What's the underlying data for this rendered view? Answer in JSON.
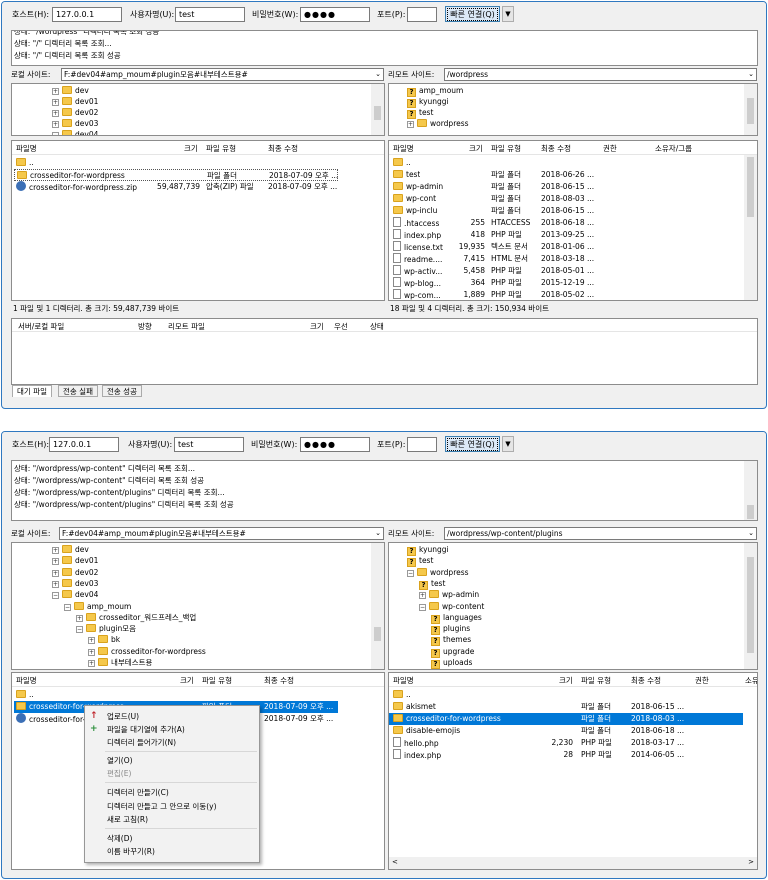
{
  "w1": {
    "qc": {
      "host_label": "호스트(H):",
      "host": "127.0.0.1",
      "user_label": "사용자명(U):",
      "user": "test",
      "pass_label": "비밀번호(W):",
      "pass": "●●●●",
      "port_label": "포트(P):",
      "port": "",
      "connect": "빠른 연결(Q)"
    },
    "log": [
      "상태:   \"/wordpress\" 디렉터리 목록 조회 성공",
      "상태:   \"/\" 디렉터리 목록 조회...",
      "상태:   \"/\" 디렉터리 목록 조회 성공"
    ],
    "local_label": "로컬 사이트:",
    "local_path": "F:#dev04#amp_moum#plugin모음#내부테스트용#",
    "remote_label": "리모트 사이트:",
    "remote_path": "/wordpress",
    "local_tree": [
      "dev",
      "dev01",
      "dev02",
      "dev03",
      "dev04"
    ],
    "remote_tree": [
      "amp_moum",
      "kyunggi",
      "test",
      "wordpress"
    ],
    "local_cols": [
      "파일명",
      "크기",
      "파일 유형",
      "최종 수정"
    ],
    "local_files": [
      {
        "name": "..",
        "size": "",
        "type": "",
        "mod": ""
      },
      {
        "name": "crosseditor-for-wordpress",
        "size": "",
        "type": "파일 폴더",
        "mod": "2018-07-09 오후 ..."
      },
      {
        "name": "crosseditor-for-wordpress.zip",
        "size": "59,487,739",
        "type": "압축(ZIP) 파일",
        "mod": "2018-07-09 오후 ..."
      }
    ],
    "remote_cols": [
      "파일명",
      "크기",
      "파일 유형",
      "최종 수정",
      "권한",
      "소유자/그룹"
    ],
    "remote_files": [
      {
        "name": "..",
        "size": "",
        "type": "",
        "mod": ""
      },
      {
        "name": "test",
        "size": "",
        "type": "파일 폴더",
        "mod": "2018-06-26 ..."
      },
      {
        "name": "wp-admin",
        "size": "",
        "type": "파일 폴더",
        "mod": "2018-06-15 ..."
      },
      {
        "name": "wp-cont",
        "size": "",
        "type": "파일 폴더",
        "mod": "2018-08-03 ..."
      },
      {
        "name": "wp-inclu",
        "size": "",
        "type": "파일 폴더",
        "mod": "2018-06-15 ..."
      },
      {
        "name": ".htaccess",
        "size": "255",
        "type": "HTACCESS",
        "mod": "2018-06-18 ..."
      },
      {
        "name": "index.php",
        "size": "418",
        "type": "PHP 파일",
        "mod": "2013-09-25 ..."
      },
      {
        "name": "license.txt",
        "size": "19,935",
        "type": "텍스트 문서",
        "mod": "2018-01-06 ..."
      },
      {
        "name": "readme....",
        "size": "7,415",
        "type": "HTML 문서",
        "mod": "2018-03-18 ..."
      },
      {
        "name": "wp-activ...",
        "size": "5,458",
        "type": "PHP 파일",
        "mod": "2018-05-01 ..."
      },
      {
        "name": "wp-blog...",
        "size": "364",
        "type": "PHP 파일",
        "mod": "2015-12-19 ..."
      },
      {
        "name": "wp-com...",
        "size": "1,889",
        "type": "PHP 파일",
        "mod": "2018-05-02 ..."
      }
    ],
    "local_status": "1 파일 및 1 디렉터리. 총 크기: 59,487,739 바이트",
    "remote_status": "18 파일 및 4 디렉터리. 총 크기: 150,934 바이트",
    "queue_cols": [
      "서버/로컬 파일",
      "방향",
      "리모트 파일",
      "크기",
      "우선",
      "상태"
    ],
    "tabs": [
      "대기 파일",
      "전송 실패",
      "전송 성공"
    ]
  },
  "w2": {
    "qc": {
      "host_label": "호스트(H):",
      "host": "127.0.0.1",
      "user_label": "사용자명(U):",
      "user": "test",
      "pass_label": "비밀번호(W):",
      "pass": "●●●●",
      "port_label": "포트(P):",
      "port": "",
      "connect": "빠른 연결(Q)"
    },
    "log": [
      "상태:   \"/wordpress/wp-content\" 디렉터리 목록 조회...",
      "상태:   \"/wordpress/wp-content\" 디렉터리 목록 조회 성공",
      "상태:   \"/wordpress/wp-content/plugins\" 디렉터리 목록 조회...",
      "상태:   \"/wordpress/wp-content/plugins\" 디렉터리 목록 조회 성공"
    ],
    "local_label": "로컬 사이트:",
    "local_path": "F:#dev04#amp_moum#plugin모음#내부테스트용#",
    "remote_label": "리모트 사이트:",
    "remote_path": "/wordpress/wp-content/plugins",
    "local_tree": [
      "dev",
      "dev01",
      "dev02",
      "dev03",
      "dev04",
      "amp_moum",
      "crosseditor_워드프레스_백업",
      "plugin모음",
      "bk",
      "crosseditor-for-wordpress",
      "내부테스트용"
    ],
    "remote_tree": [
      "kyunggi",
      "test",
      "wordpress",
      "test",
      "wp-admin",
      "wp-content",
      "languages",
      "plugins",
      "themes",
      "upgrade",
      "uploads"
    ],
    "local_cols": [
      "파일명",
      "크기",
      "파일 유형",
      "최종 수정"
    ],
    "local_files": [
      {
        "name": "..",
        "size": "",
        "type": "",
        "mod": ""
      },
      {
        "name": "crosseditor-for-wordpress",
        "size": "",
        "type": "파일 폴더",
        "mod": "2018-07-09 오후 ..."
      },
      {
        "name": "crosseditor-for-wordpress.zip",
        "size": "",
        "type": "",
        "mod": "2018-07-09 오후 ..."
      }
    ],
    "remote_cols": [
      "파일명",
      "크기",
      "파일 유형",
      "최종 수정",
      "권한",
      "소유자"
    ],
    "remote_files": [
      {
        "name": "..",
        "size": "",
        "type": "",
        "mod": ""
      },
      {
        "name": "akismet",
        "size": "",
        "type": "파일 폴더",
        "mod": "2018-06-15 ..."
      },
      {
        "name": "crosseditor-for-wordpress",
        "size": "",
        "type": "파일 폴더",
        "mod": "2018-08-03 ..."
      },
      {
        "name": "disable-emojis",
        "size": "",
        "type": "파일 폴더",
        "mod": "2018-06-18 ..."
      },
      {
        "name": "hello.php",
        "size": "2,230",
        "type": "PHP 파일",
        "mod": "2018-03-17 ..."
      },
      {
        "name": "index.php",
        "size": "28",
        "type": "PHP 파일",
        "mod": "2014-06-05 ..."
      }
    ],
    "menu": [
      "업로드(U)",
      "파일을 대기열에 추가(A)",
      "디렉터리 들어가기(N)",
      "열기(O)",
      "편집(E)",
      "디렉터리 만들기(C)",
      "디렉터리 만들고 그 안으로 이동(y)",
      "새로 고침(R)",
      "삭제(D)",
      "이름 바꾸기(R)"
    ]
  },
  "colors": {
    "accent": "#0078d7",
    "border": "#2f78c0",
    "folder": "#f5c84b"
  },
  "icons": [
    "folder-icon",
    "unknown-folder-icon",
    "file-icon",
    "zip-icon",
    "upload-icon",
    "add-queue-icon"
  ]
}
